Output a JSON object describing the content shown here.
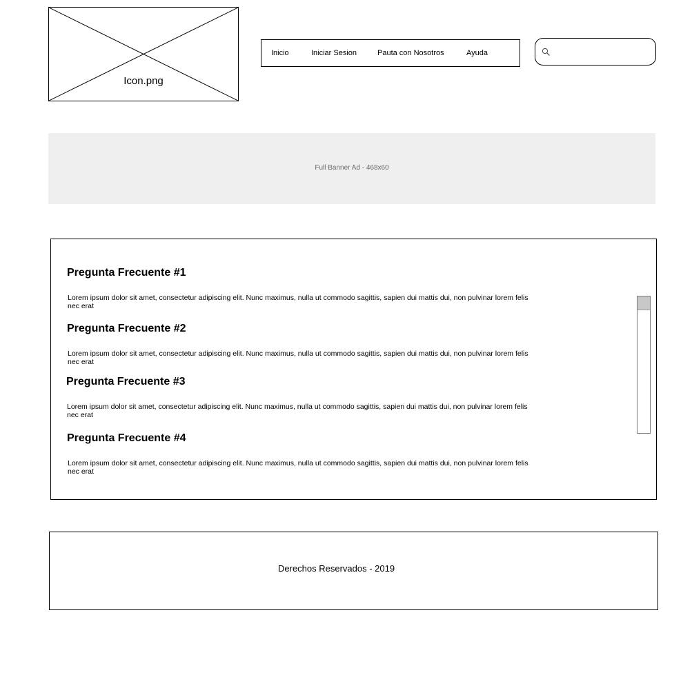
{
  "header": {
    "logo_label": "Icon.png",
    "nav": {
      "items": [
        {
          "label": "Inicio"
        },
        {
          "label": "Iniciar Sesion"
        },
        {
          "label": "Pauta con Nosotros"
        },
        {
          "label": "Ayuda"
        }
      ]
    },
    "search": {
      "value": "",
      "placeholder": "",
      "icon": "search-icon"
    }
  },
  "banner": {
    "label": "Full Banner Ad - 468x60"
  },
  "faq": {
    "items": [
      {
        "question": "Pregunta Frecuente #1",
        "answer": "Lorem ipsum dolor sit amet, consectetur adipiscing elit. Nunc maximus, nulla ut commodo sagittis, sapien dui mattis dui, non pulvinar lorem felis nec erat"
      },
      {
        "question": "Pregunta Frecuente #2",
        "answer": "Lorem ipsum dolor sit amet, consectetur adipiscing elit. Nunc maximus, nulla ut commodo sagittis, sapien dui mattis dui, non pulvinar lorem felis nec erat"
      },
      {
        "question": "Pregunta Frecuente #3",
        "answer": "Lorem ipsum dolor sit amet, consectetur adipiscing elit. Nunc maximus, nulla ut commodo sagittis, sapien dui mattis dui, non pulvinar lorem felis nec erat"
      },
      {
        "question": "Pregunta Frecuente #4",
        "answer": "Lorem ipsum dolor sit amet, consectetur adipiscing elit. Nunc maximus, nulla ut commodo sagittis, sapien dui mattis dui, non pulvinar lorem felis nec erat"
      }
    ]
  },
  "footer": {
    "text": "Derechos Reservados - 2019"
  },
  "colors": {
    "border": "#000000",
    "banner_bg": "#efefef",
    "banner_text": "#6b6b6b",
    "scroll_thumb": "#c8c8c8"
  }
}
